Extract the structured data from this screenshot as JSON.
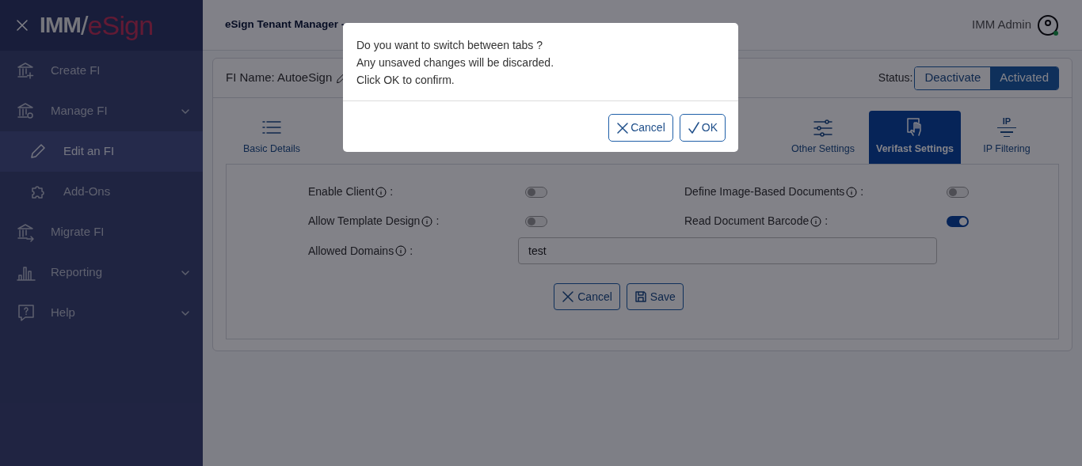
{
  "sidebar": {
    "logo": {
      "left": "IMM",
      "separator": "/",
      "right": "eSign"
    },
    "items": [
      {
        "label": "Create FI",
        "kind": "bank-plus",
        "selected": false
      },
      {
        "label": "Manage FI",
        "kind": "bank-gear",
        "group": true,
        "selected": false,
        "children": [
          {
            "label": "Edit an FI",
            "kind": "pencil",
            "selected": true
          },
          {
            "label": "Add-Ons",
            "kind": "puzzle",
            "selected": false
          }
        ]
      },
      {
        "label": "Migrate FI",
        "kind": "bank-arrow",
        "selected": false
      },
      {
        "label": "Reporting",
        "kind": "chart",
        "group": true,
        "selected": false
      },
      {
        "label": "Help",
        "kind": "help",
        "group": true,
        "selected": false
      }
    ]
  },
  "header": {
    "title": "eSign Tenant Manager -",
    "user": "IMM Admin",
    "online": true
  },
  "fi": {
    "name_label": "FI Name: AutoeSign",
    "status_label": "Status:",
    "status_options": [
      {
        "label": "Deactivate",
        "selected": false
      },
      {
        "label": "Activated",
        "selected": true
      }
    ]
  },
  "tabs": [
    {
      "label": "Basic Details",
      "kind": "list",
      "selected": false
    },
    {
      "label": "Other Settings",
      "kind": "sliders",
      "selected": false
    },
    {
      "label": "Verifast Settings",
      "kind": "hand",
      "selected": true
    },
    {
      "label": "IP Filtering",
      "kind": "ip",
      "icon_text": "IP",
      "selected": false
    }
  ],
  "settings": [
    {
      "label": "Enable Client",
      "suffix": ":",
      "on": false
    },
    {
      "label": "Define Image-Based Documents",
      "suffix": ":",
      "on": false
    },
    {
      "label": "Allow Template Design",
      "suffix": ":",
      "on": false
    },
    {
      "label": "Read Document Barcode",
      "suffix": ":",
      "on": true
    }
  ],
  "allowed_domains": {
    "label": "Allowed Domains",
    "suffix": ":",
    "value": "test"
  },
  "form_buttons": [
    {
      "label": "Cancel",
      "kind": "x"
    },
    {
      "label": "Save",
      "kind": "save"
    }
  ],
  "dialog": {
    "lines": [
      "Do you want to switch between tabs ?",
      "Any unsaved changes will be discarded.",
      "Click OK to confirm."
    ],
    "buttons": [
      {
        "label": "Cancel",
        "kind": "x"
      },
      {
        "label": "OK",
        "kind": "check"
      }
    ]
  }
}
